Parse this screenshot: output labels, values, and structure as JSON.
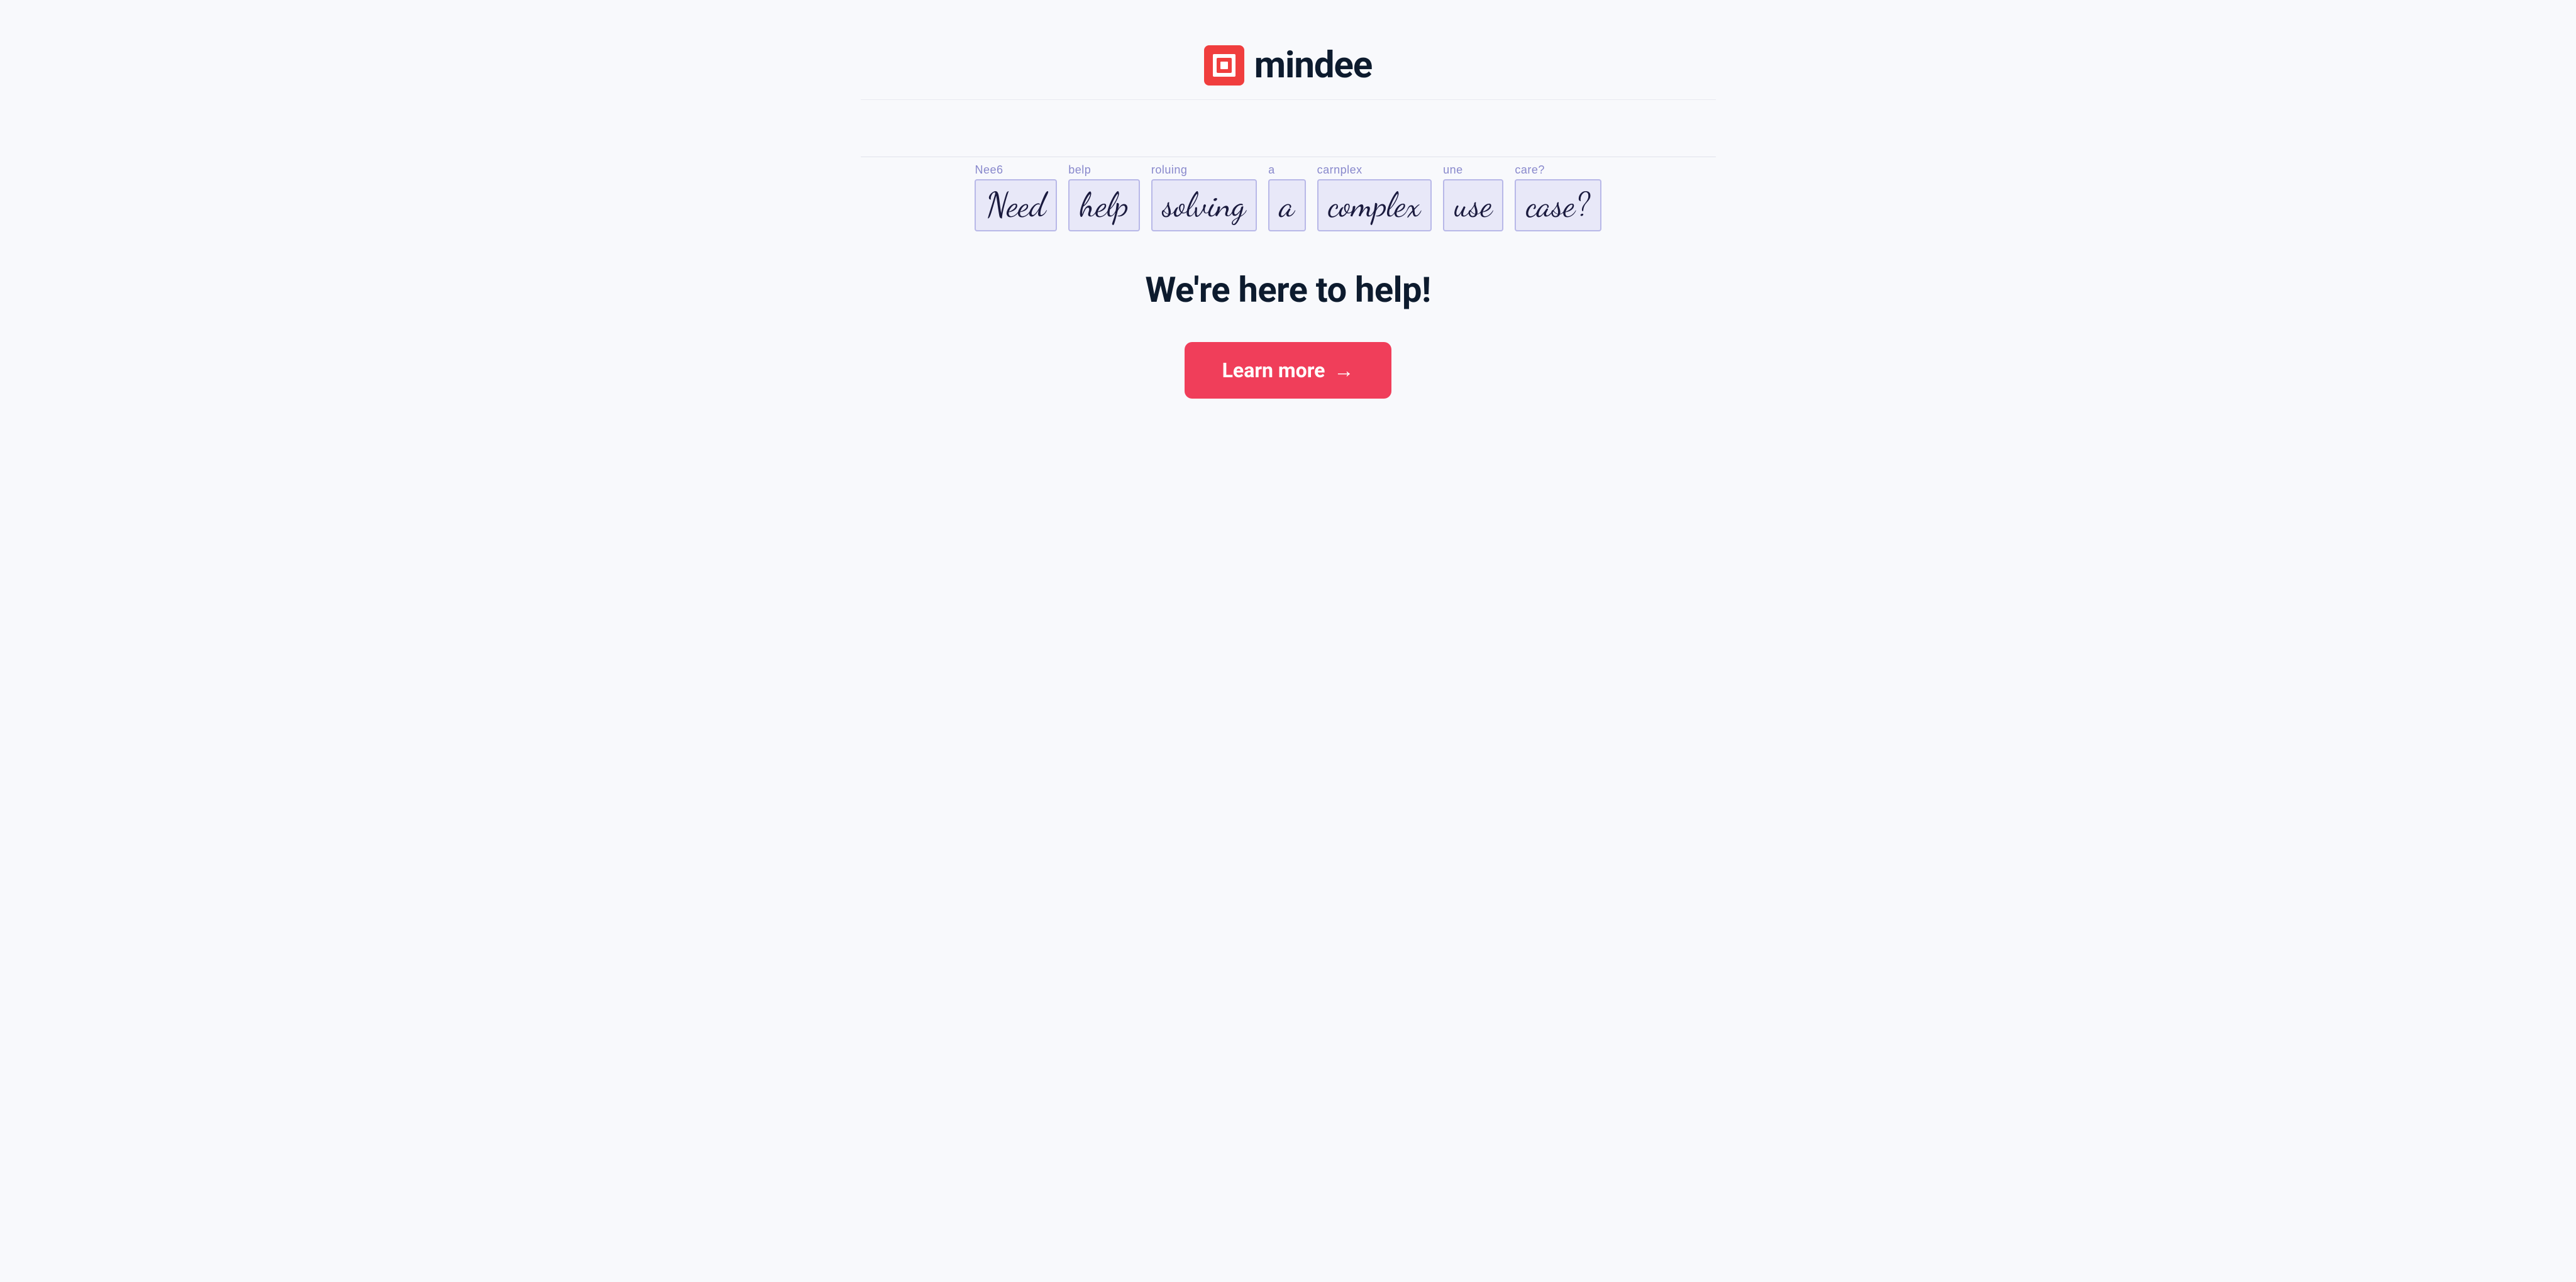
{
  "header": {
    "logo_text": "mindee",
    "logo_icon_alt": "mindee-logo-icon"
  },
  "handwriting": {
    "words": [
      {
        "ocr_label": "Nee6",
        "handwritten": "Need"
      },
      {
        "ocr_label": "belp",
        "handwritten": "help"
      },
      {
        "ocr_label": "roluing",
        "handwritten": "solving"
      },
      {
        "ocr_label": "a",
        "handwritten": "a"
      },
      {
        "ocr_label": "carnplex",
        "handwritten": "complex"
      },
      {
        "ocr_label": "une",
        "handwritten": "use"
      },
      {
        "ocr_label": "care?",
        "handwritten": "case?"
      }
    ]
  },
  "main": {
    "subtitle": "We're here to help!",
    "cta_label": "Learn more",
    "cta_arrow": "→"
  },
  "colors": {
    "logo_red": "#f03e3e",
    "navy": "#0d1b2e",
    "cta_red": "#f03e5a",
    "handwriting_bg": "#e8e8f8",
    "handwriting_border": "#b8b8e8",
    "ocr_label_color": "#8888cc"
  }
}
